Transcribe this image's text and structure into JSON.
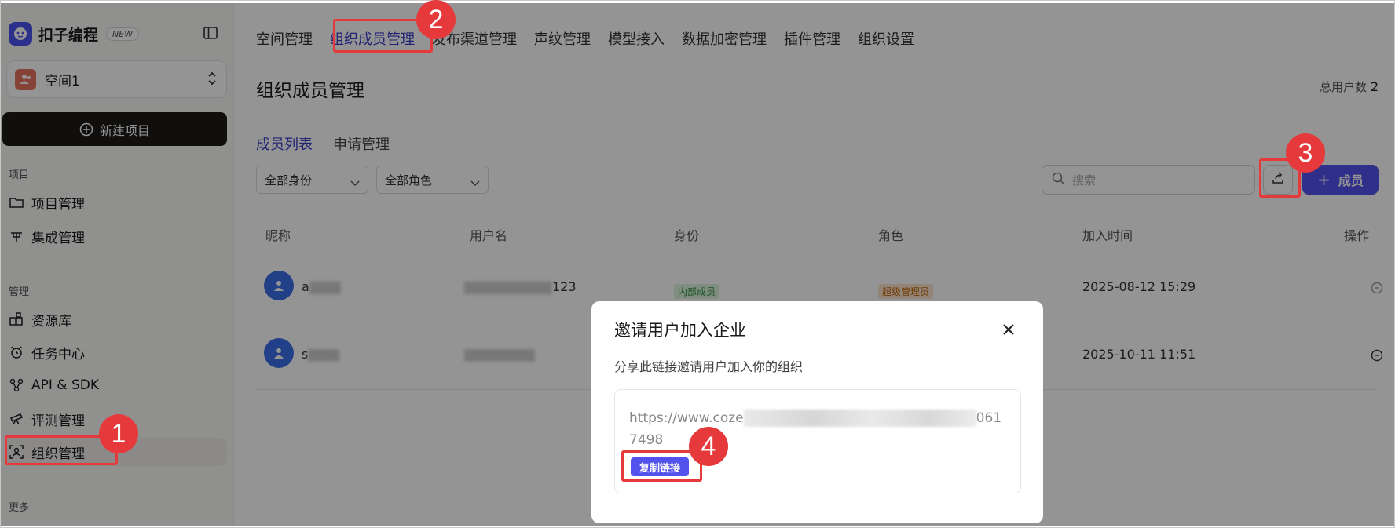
{
  "brand": {
    "name": "扣子编程",
    "badge": "NEW"
  },
  "space": {
    "name": "空间1"
  },
  "sidebar": {
    "new_project": "新建项目",
    "section_project": "项目",
    "section_manage": "管理",
    "section_more": "更多",
    "items": [
      {
        "label": "项目管理",
        "icon": "folder-icon"
      },
      {
        "label": "集成管理",
        "icon": "integration-icon"
      },
      {
        "label": "资源库",
        "icon": "resource-library-icon"
      },
      {
        "label": "任务中心",
        "icon": "alarm-clock-icon"
      },
      {
        "label": "API & SDK",
        "icon": "api-icon"
      },
      {
        "label": "评测管理",
        "icon": "telescope-icon"
      },
      {
        "label": "组织管理",
        "icon": "organization-icon",
        "active": true
      }
    ]
  },
  "top_tabs": [
    "空间管理",
    "组织成员管理",
    "发布渠道管理",
    "声纹管理",
    "模型接入",
    "数据加密管理",
    "插件管理",
    "组织设置"
  ],
  "page": {
    "title": "组织成员管理",
    "total_label": "总用户数",
    "total_count": "2"
  },
  "sub_tabs": [
    "成员列表",
    "申请管理"
  ],
  "filters": {
    "identity": "全部身份",
    "role": "全部角色"
  },
  "search": {
    "placeholder": "搜索"
  },
  "add_member": "成员",
  "table": {
    "headers": [
      "昵称",
      "用户名",
      "身份",
      "角色",
      "加入时间",
      "操作"
    ],
    "rows": [
      {
        "nick_prefix": "a",
        "username_suffix": "123",
        "identity": "内部成员",
        "role": "超级管理员",
        "joined": "2025-08-12 15:29"
      },
      {
        "nick_prefix": "s",
        "username_suffix": "",
        "identity": "",
        "role": "",
        "joined": "2025-10-11 11:51"
      }
    ]
  },
  "modal": {
    "title": "邀请用户加入企业",
    "description": "分享此链接邀请用户加入你的组织",
    "link_start": "https://www.coze",
    "link_end": "0617498",
    "copy_label": "复制链接"
  },
  "annotations": [
    "1",
    "2",
    "3",
    "4"
  ],
  "colors": {
    "accent": "#5352ed",
    "annotation": "#e5393b",
    "active_tab": "#3d3dc8"
  }
}
